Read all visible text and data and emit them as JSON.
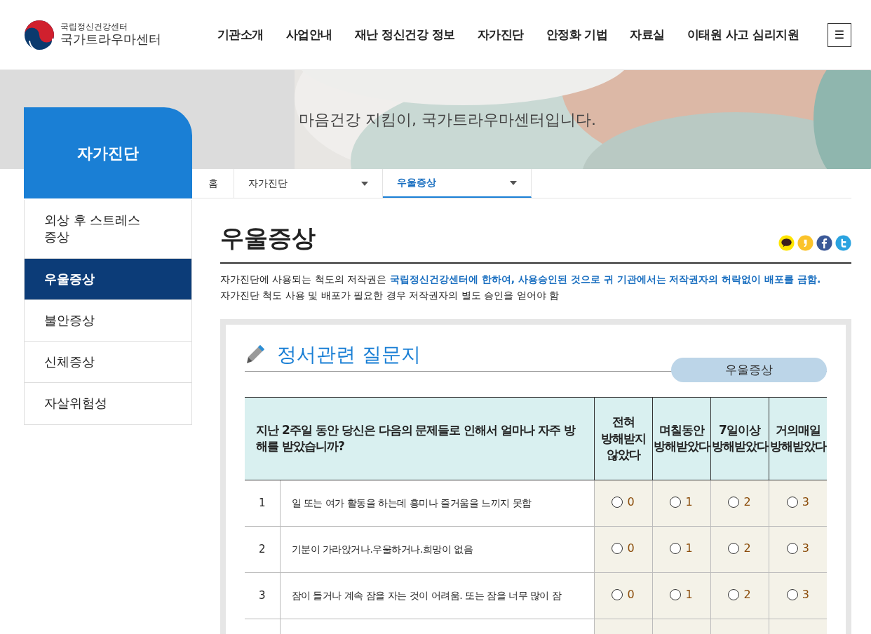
{
  "logo": {
    "subtitle": "국립정신건강센터",
    "title": "국가트라우마센터"
  },
  "nav": [
    {
      "label": "기관소개"
    },
    {
      "label": "사업안내"
    },
    {
      "label": "재난 정신건강 정보"
    },
    {
      "label": "자가진단"
    },
    {
      "label": "안정화 기법"
    },
    {
      "label": "자료실"
    },
    {
      "label": "이태원 사고 심리지원"
    }
  ],
  "menu_button": {
    "label": "☰"
  },
  "banner": {
    "kind": "picture",
    "slogan": "마음건강 지킴이, 국가트라우마센터입니다."
  },
  "sidebar": {
    "title": "자가진단",
    "items": [
      {
        "label": "외상 후 스트레스\n증상",
        "selected": false
      },
      {
        "label": "우울증상",
        "selected": true
      },
      {
        "label": "불안증상",
        "selected": false
      },
      {
        "label": "신체증상",
        "selected": false
      },
      {
        "label": "자살위험성",
        "selected": false
      }
    ]
  },
  "breadcrumb": {
    "home": "홈",
    "dropdowns": [
      {
        "label": "자가진단",
        "selected": false
      },
      {
        "label": "우울증상",
        "selected": true
      }
    ]
  },
  "page_title": "우울증상",
  "notice": [
    "자가진단에 사용되는 척도의 저작권은 **국립정신건강센터에 한하여, 사용승인된 것으로 귀 기관에서는 저작권자의 허락없이 배포를 금함.**",
    "자가진단 척도 사용 및 배포가 필요한 경우 저작권자의 별도 승인을 얻어야 함"
  ],
  "questionnaire": {
    "title": "정서관련 질문지",
    "tag": "우울증상",
    "columns": [
      "지난 2주일 동안 당신은 다음의 문제들로 인해서 얼마나 자주 방해를 받았습니까?",
      "전혀\n방해받지\n않았다",
      "며칠동안\n방해받았다",
      "7일이상\n방해받았다",
      "거의매일\n방해받았다"
    ],
    "rows": [
      {
        "number": "1",
        "question": "일 또는 여가 활동을 하는데 흥미나 즐거움을 느끼지 못함",
        "options": [
          {
            "label": "0",
            "selected": false
          },
          {
            "label": "1",
            "selected": false
          },
          {
            "label": "2",
            "selected": false
          },
          {
            "label": "3",
            "selected": false
          }
        ]
      },
      {
        "number": "2",
        "question": "기분이 가라앉거나.우울하거나.희망이 없음",
        "options": [
          {
            "label": "0",
            "selected": false
          },
          {
            "label": "1",
            "selected": false
          },
          {
            "label": "2",
            "selected": false
          },
          {
            "label": "3",
            "selected": false
          }
        ]
      },
      {
        "number": "3",
        "question": "잠이 들거나 계속 잠을 자는 것이 어려움. 또는 잠을 너무 많이 잠",
        "options": [
          {
            "label": "0",
            "selected": false
          },
          {
            "label": "1",
            "selected": false
          },
          {
            "label": "2",
            "selected": false
          },
          {
            "label": "3",
            "selected": false
          }
        ]
      }
    ]
  }
}
